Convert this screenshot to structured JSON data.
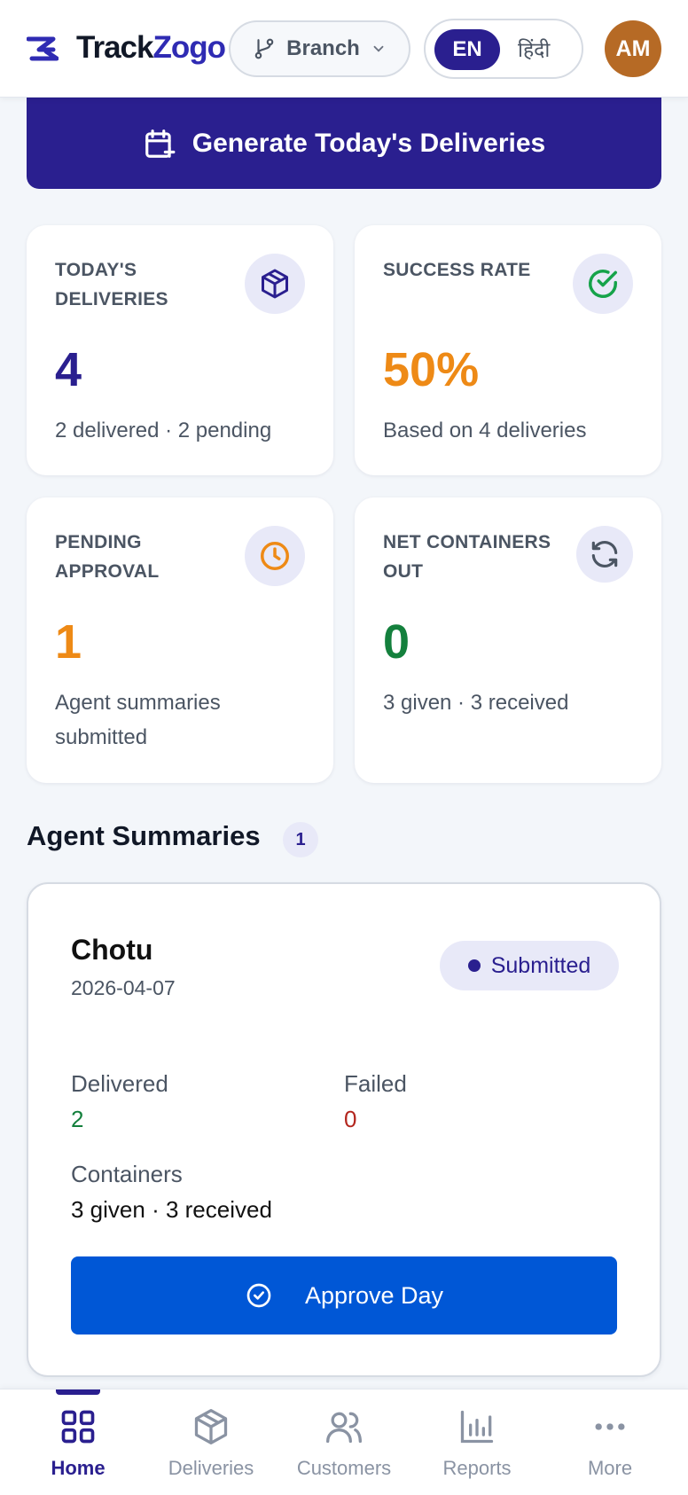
{
  "header": {
    "logo_track": "Track",
    "logo_zogo": "Zogo",
    "branch_label": "Branch",
    "lang_en": "EN",
    "lang_hi": "हिंदी",
    "avatar_initials": "AM"
  },
  "generate_button_label": "Generate Today's Deliveries",
  "stats": {
    "todays_deliveries": {
      "label": "TODAY'S DELIVERIES",
      "value": "4",
      "sub": "2 delivered · 2 pending",
      "icon": "box-icon"
    },
    "success_rate": {
      "label": "SUCCESS RATE",
      "value": "50%",
      "sub": "Based on 4 deliveries",
      "icon": "check-circle-icon"
    },
    "pending_approval": {
      "label": "PENDING APPROVAL",
      "value": "1",
      "sub": "Agent summaries submitted",
      "icon": "clock-icon"
    },
    "net_containers": {
      "label": "NET CONTAINERS OUT",
      "value": "0",
      "sub": "3 given · 3 received",
      "icon": "refresh-icon"
    }
  },
  "section": {
    "title": "Agent Summaries",
    "count": "1"
  },
  "summary": {
    "agent_name": "Chotu",
    "date": "2026-04-07",
    "status": "Submitted",
    "delivered_label": "Delivered",
    "delivered_value": "2",
    "failed_label": "Failed",
    "failed_value": "0",
    "containers_label": "Containers",
    "containers_value": "3 given · 3 received",
    "approve_label": "Approve Day"
  },
  "nav": {
    "home": "Home",
    "deliveries": "Deliveries",
    "customers": "Customers",
    "reports": "Reports",
    "more": "More"
  },
  "colors": {
    "primary": "#2a1f8f",
    "orange": "#ee8a16",
    "green": "#14803d",
    "red": "#b3261e",
    "blue": "#0057d6"
  }
}
